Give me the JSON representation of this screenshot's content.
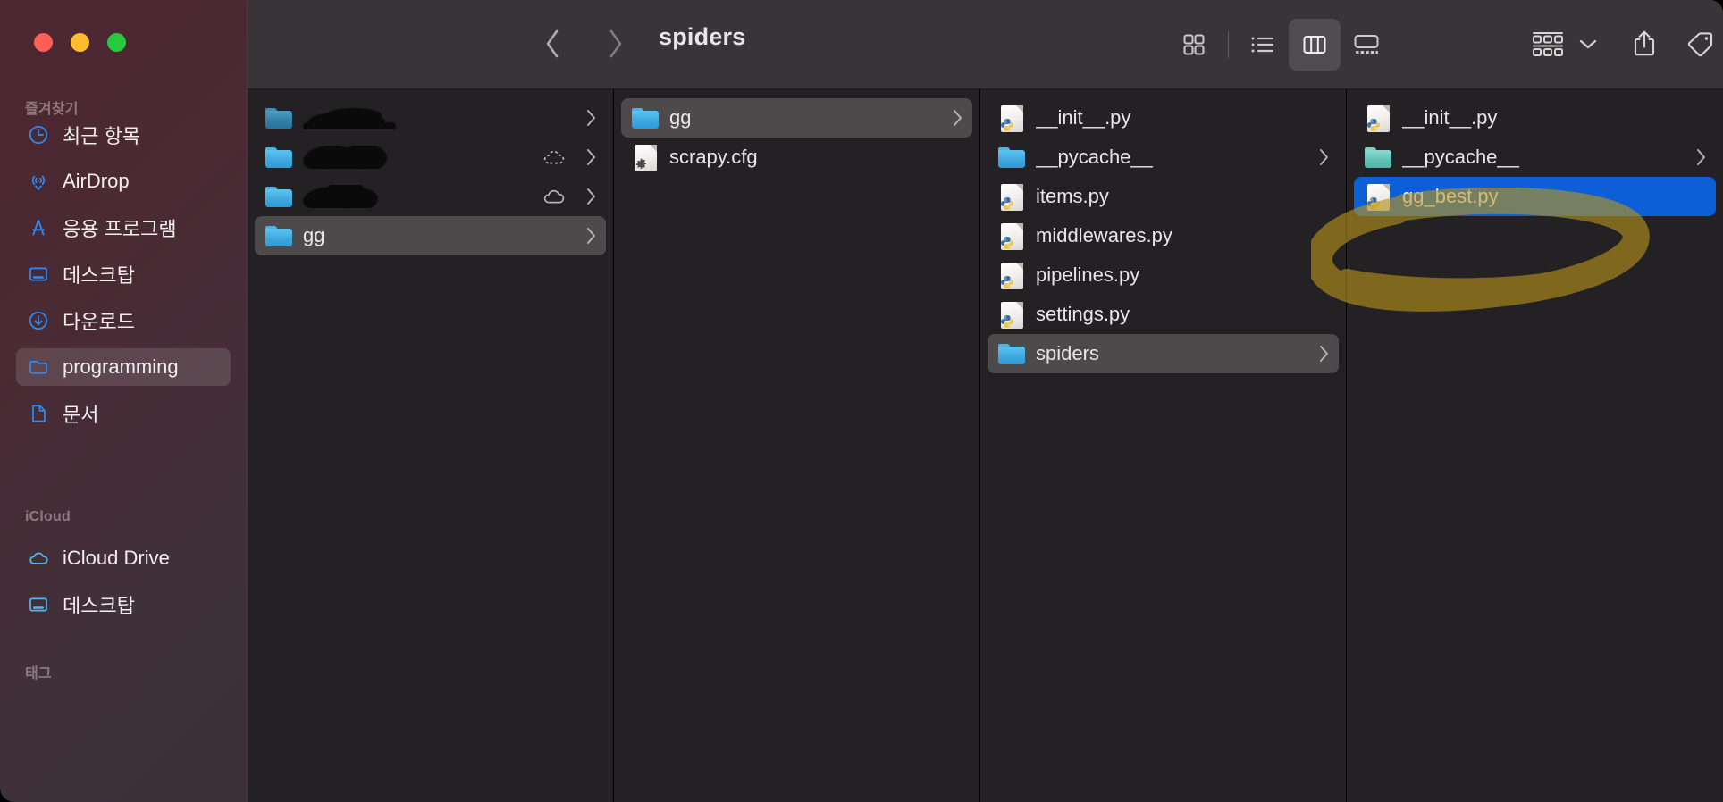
{
  "window": {
    "title": "spiders",
    "traffic_lights": [
      "close",
      "minimize",
      "zoom"
    ],
    "accent_selection_color": "#0c5fd6",
    "sidebar_tint_color": "#4a2a33",
    "toolbar_color": "#383437",
    "content_background_color": "#232123",
    "annotation_highlight_color": "#a8861a"
  },
  "toolbar": {
    "back_label": "Back",
    "forward_label": "Forward",
    "title": "spiders",
    "view_modes": [
      {
        "name": "icon-view",
        "label": "As Icons",
        "active": false
      },
      {
        "name": "list-view",
        "label": "As List",
        "active": false
      },
      {
        "name": "column-view",
        "label": "As Columns",
        "active": true
      },
      {
        "name": "gallery-view",
        "label": "As Gallery",
        "active": false
      }
    ],
    "group_label": "Group",
    "share_label": "Share",
    "tag_label": "Tags",
    "more_label": "More",
    "search_label": "Search"
  },
  "sidebar": {
    "sections": [
      {
        "name": "favorites",
        "label": "즐겨찾기"
      },
      {
        "name": "icloud",
        "label": "iCloud"
      },
      {
        "name": "tags",
        "label": "태그"
      }
    ],
    "favorites": [
      {
        "label": "최근 항목",
        "icon": "clock-icon",
        "selected": false
      },
      {
        "label": "AirDrop",
        "icon": "airdrop-icon",
        "selected": false
      },
      {
        "label": "응용 프로그램",
        "icon": "applications-icon",
        "selected": false
      },
      {
        "label": "데스크탑",
        "icon": "desktop-icon",
        "selected": false
      },
      {
        "label": "다운로드",
        "icon": "downloads-icon",
        "selected": false
      },
      {
        "label": "programming",
        "icon": "folder-icon",
        "selected": true
      },
      {
        "label": "문서",
        "icon": "document-icon",
        "selected": false
      }
    ],
    "icloud": [
      {
        "label": "iCloud Drive",
        "icon": "cloud-icon",
        "selected": false
      },
      {
        "label": "데스크탑",
        "icon": "desktop-icon",
        "selected": false
      }
    ],
    "tags": []
  },
  "columns": [
    {
      "name": "column-1",
      "items": [
        {
          "label": "",
          "redacted": true,
          "kind": "folder",
          "chevron": true,
          "cloud": "none",
          "selected": false
        },
        {
          "label": "",
          "redacted": true,
          "kind": "folder",
          "chevron": true,
          "cloud": "dashed",
          "selected": false
        },
        {
          "label": "",
          "redacted": true,
          "kind": "folder",
          "chevron": true,
          "cloud": "solid",
          "selected": false
        },
        {
          "label": "gg",
          "redacted": false,
          "kind": "folder",
          "chevron": true,
          "cloud": "none",
          "selected": true
        }
      ]
    },
    {
      "name": "column-2",
      "items": [
        {
          "label": "gg",
          "kind": "folder",
          "chevron": true,
          "selected": true
        },
        {
          "label": "scrapy.cfg",
          "kind": "config",
          "chevron": false,
          "selected": false
        }
      ]
    },
    {
      "name": "column-3",
      "items": [
        {
          "label": "__init__.py",
          "kind": "python",
          "chevron": false,
          "selected": false
        },
        {
          "label": "__pycache__",
          "kind": "folder",
          "chevron": true,
          "selected": false
        },
        {
          "label": "items.py",
          "kind": "python",
          "chevron": false,
          "selected": false
        },
        {
          "label": "middlewares.py",
          "kind": "python",
          "chevron": false,
          "selected": false
        },
        {
          "label": "pipelines.py",
          "kind": "python",
          "chevron": false,
          "selected": false
        },
        {
          "label": "settings.py",
          "kind": "python",
          "chevron": false,
          "selected": false
        },
        {
          "label": "spiders",
          "kind": "folder",
          "chevron": true,
          "selected": true
        }
      ]
    },
    {
      "name": "column-4",
      "items": [
        {
          "label": "__init__.py",
          "kind": "python",
          "chevron": false,
          "selected": false
        },
        {
          "label": "__pycache__",
          "kind": "folder-teal",
          "chevron": true,
          "selected": false
        },
        {
          "label": "gg_best.py",
          "kind": "python",
          "chevron": false,
          "selected": true
        }
      ]
    }
  ],
  "annotation": {
    "name": "highlighter-oval",
    "color": "#a8861a",
    "encircles": [
      "__pycache__",
      "gg_best.py"
    ]
  }
}
